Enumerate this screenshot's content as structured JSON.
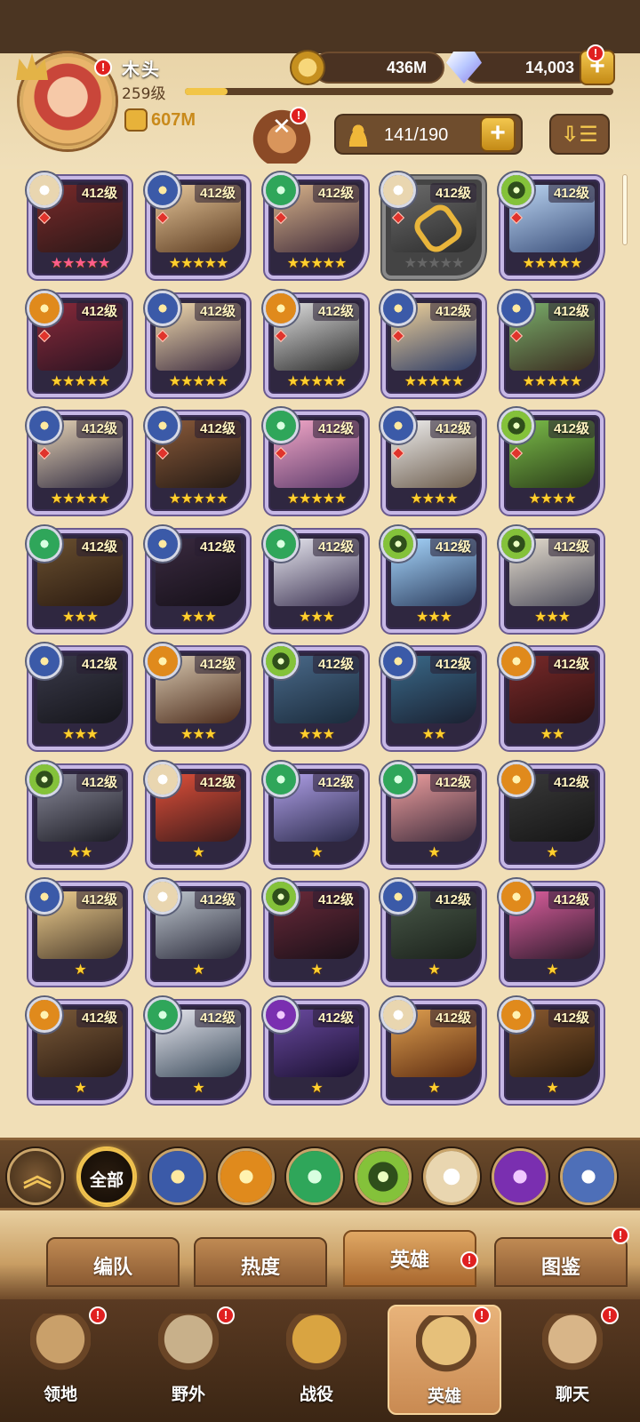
{
  "player": {
    "name": "木头",
    "level": "259级",
    "xp_fraction": 0.1,
    "power": "607M"
  },
  "resources": {
    "gold": "436M",
    "diamonds": "14,003"
  },
  "hero_count": "141/190",
  "notification_badge": "!",
  "colors": {
    "accent": "#f0c24e",
    "badge": "#e02020",
    "card_border": "#c7b8e6",
    "star": "#ffcf2e",
    "star_top": "#ff5d8a"
  },
  "heroes": [
    {
      "level": "412级",
      "stars": 5,
      "faction": "celestial",
      "tier": "pink",
      "owned": true
    },
    {
      "level": "412级",
      "stars": 5,
      "faction": "lightbearer",
      "owned": true
    },
    {
      "level": "412级",
      "stars": 5,
      "faction": "wilder",
      "owned": true
    },
    {
      "level": "412级",
      "stars": 5,
      "faction": "celestial",
      "tier": "gray",
      "owned": false
    },
    {
      "level": "412级",
      "stars": 5,
      "faction": "graveborn",
      "owned": true
    },
    {
      "level": "412级",
      "stars": 5,
      "faction": "mauler",
      "owned": true
    },
    {
      "level": "412级",
      "stars": 5,
      "faction": "lightbearer",
      "owned": true
    },
    {
      "level": "412级",
      "stars": 5,
      "faction": "mauler",
      "owned": true
    },
    {
      "level": "412级",
      "stars": 5,
      "faction": "lightbearer",
      "owned": true
    },
    {
      "level": "412级",
      "stars": 5,
      "faction": "lightbearer",
      "owned": true
    },
    {
      "level": "412级",
      "stars": 5,
      "faction": "lightbearer",
      "owned": true
    },
    {
      "level": "412级",
      "stars": 5,
      "faction": "lightbearer",
      "owned": true
    },
    {
      "level": "412级",
      "stars": 5,
      "faction": "wilder",
      "owned": true
    },
    {
      "level": "412级",
      "stars": 4,
      "faction": "lightbearer",
      "owned": true
    },
    {
      "level": "412级",
      "stars": 4,
      "faction": "graveborn",
      "owned": true
    },
    {
      "level": "412级",
      "stars": 3,
      "faction": "wilder",
      "owned": true
    },
    {
      "level": "412级",
      "stars": 3,
      "faction": "lightbearer",
      "owned": true
    },
    {
      "level": "412级",
      "stars": 3,
      "faction": "wilder",
      "owned": true
    },
    {
      "level": "412级",
      "stars": 3,
      "faction": "graveborn",
      "owned": true
    },
    {
      "level": "412级",
      "stars": 3,
      "faction": "graveborn",
      "owned": true
    },
    {
      "level": "412级",
      "stars": 3,
      "faction": "lightbearer",
      "owned": true
    },
    {
      "level": "412级",
      "stars": 3,
      "faction": "mauler",
      "owned": true
    },
    {
      "level": "412级",
      "stars": 3,
      "faction": "graveborn",
      "owned": true
    },
    {
      "level": "412级",
      "stars": 2,
      "faction": "lightbearer",
      "owned": true
    },
    {
      "level": "412级",
      "stars": 2,
      "faction": "mauler",
      "owned": true
    },
    {
      "level": "412级",
      "stars": 2,
      "faction": "graveborn",
      "owned": true
    },
    {
      "level": "412级",
      "stars": 1,
      "faction": "celestial",
      "owned": true
    },
    {
      "level": "412级",
      "stars": 1,
      "faction": "wilder",
      "owned": true
    },
    {
      "level": "412级",
      "stars": 1,
      "faction": "wilder",
      "owned": true
    },
    {
      "level": "412级",
      "stars": 1,
      "faction": "mauler",
      "owned": true
    },
    {
      "level": "412级",
      "stars": 1,
      "faction": "lightbearer",
      "owned": true
    },
    {
      "level": "412级",
      "stars": 1,
      "faction": "celestial",
      "owned": true
    },
    {
      "level": "412级",
      "stars": 1,
      "faction": "graveborn",
      "owned": true
    },
    {
      "level": "412级",
      "stars": 1,
      "faction": "lightbearer",
      "owned": true
    },
    {
      "level": "412级",
      "stars": 1,
      "faction": "mauler",
      "owned": true
    },
    {
      "level": "412级",
      "stars": 1,
      "faction": "mauler",
      "owned": true
    },
    {
      "level": "412级",
      "stars": 1,
      "faction": "wilder",
      "owned": true
    },
    {
      "level": "412级",
      "stars": 1,
      "faction": "hypogean",
      "owned": true
    },
    {
      "level": "412级",
      "stars": 1,
      "faction": "celestial",
      "owned": true
    },
    {
      "level": "412级",
      "stars": 1,
      "faction": "mauler",
      "owned": true
    }
  ],
  "filters": {
    "collapse_icon": "chevron-up-icon",
    "all_label": "全部",
    "factions": [
      "lightbearer",
      "mauler",
      "wilder",
      "graveborn",
      "celestial",
      "hypogean",
      "dimensional"
    ]
  },
  "section_tabs": [
    {
      "label": "编队",
      "active": false,
      "badge": false
    },
    {
      "label": "热度",
      "active": false,
      "badge": false
    },
    {
      "label": "英雄",
      "active": true,
      "badge": true
    },
    {
      "label": "图鉴",
      "active": false,
      "badge": true
    }
  ],
  "bottom_nav": [
    {
      "label": "领地",
      "icon": "castle-icon",
      "badge": true,
      "active": false
    },
    {
      "label": "野外",
      "icon": "scroll-map-icon",
      "badge": true,
      "active": false
    },
    {
      "label": "战役",
      "icon": "sword-shield-icon",
      "badge": false,
      "active": false
    },
    {
      "label": "英雄",
      "icon": "helmet-icon",
      "badge": true,
      "active": true
    },
    {
      "label": "聊天",
      "icon": "chat-bubble-icon",
      "badge": true,
      "active": false
    }
  ]
}
